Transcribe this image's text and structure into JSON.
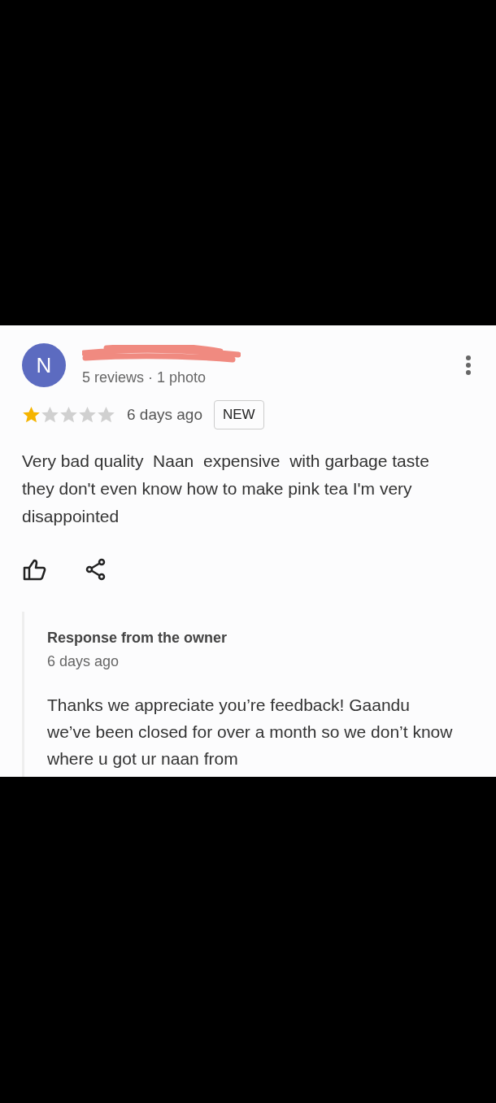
{
  "review": {
    "avatar_letter": "N",
    "meta": "5 reviews · 1 photo",
    "stars": 1,
    "time": "6 days ago",
    "badge": "NEW",
    "text": "Very bad quality  Naan  expensive  with garbage taste they don't even know how to make pink tea I'm very disappointed"
  },
  "owner_response": {
    "title": "Response from the owner",
    "time": "6 days ago",
    "text": "Thanks we appreciate you’re feedback! Gaandu we’ve been closed for over a month so we don’t know where u got ur naan from"
  }
}
